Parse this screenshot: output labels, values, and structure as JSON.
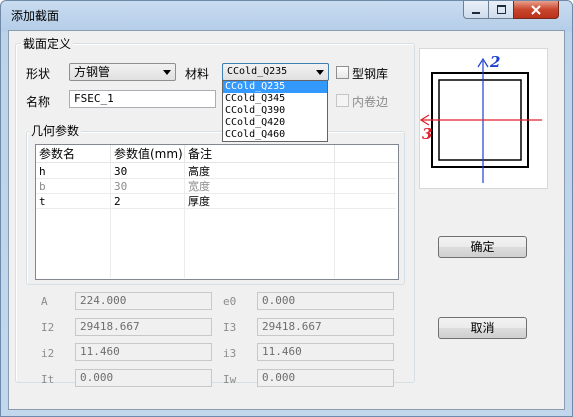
{
  "window": {
    "title": "添加截面"
  },
  "group_def": {
    "title": "截面定义"
  },
  "shape": {
    "label": "形状",
    "value": "方钢管"
  },
  "material": {
    "label": "材料",
    "value": "CCold_Q235",
    "options": [
      "CCold_Q235",
      "CCold_Q345",
      "CCold_Q390",
      "CCold_Q420",
      "CCold_Q460"
    ]
  },
  "steel_lib": {
    "label": "型钢库"
  },
  "inner_curl": {
    "label": "内卷边"
  },
  "name": {
    "label": "名称",
    "value": "FSEC_1"
  },
  "geo_group": {
    "title": "几何参数"
  },
  "table": {
    "headers": [
      "参数名",
      "参数值(mm)",
      "备注"
    ],
    "rows": [
      {
        "name": "h",
        "value": "30",
        "note": "高度",
        "enabled": true
      },
      {
        "name": "b",
        "value": "30",
        "note": "宽度",
        "enabled": false
      },
      {
        "name": "t",
        "value": "2",
        "note": "厚度",
        "enabled": true
      }
    ]
  },
  "props": {
    "A": {
      "label": "A",
      "value": "224.000"
    },
    "e0": {
      "label": "e0",
      "value": "0.000"
    },
    "I2": {
      "label": "I2",
      "value": "29418.667"
    },
    "I3": {
      "label": "I3",
      "value": "29418.667"
    },
    "i2": {
      "label": "i2",
      "value": "11.460"
    },
    "i3": {
      "label": "i3",
      "value": "11.460"
    },
    "It": {
      "label": "It",
      "value": "0.000"
    },
    "Iw": {
      "label": "Iw",
      "value": "0.000"
    }
  },
  "diagram": {
    "axis2": "2",
    "axis3": "3",
    "axis2_color": "#1e3fd0",
    "axis3_color": "#e0202a"
  },
  "buttons": {
    "ok": "确定",
    "cancel": "取消"
  }
}
